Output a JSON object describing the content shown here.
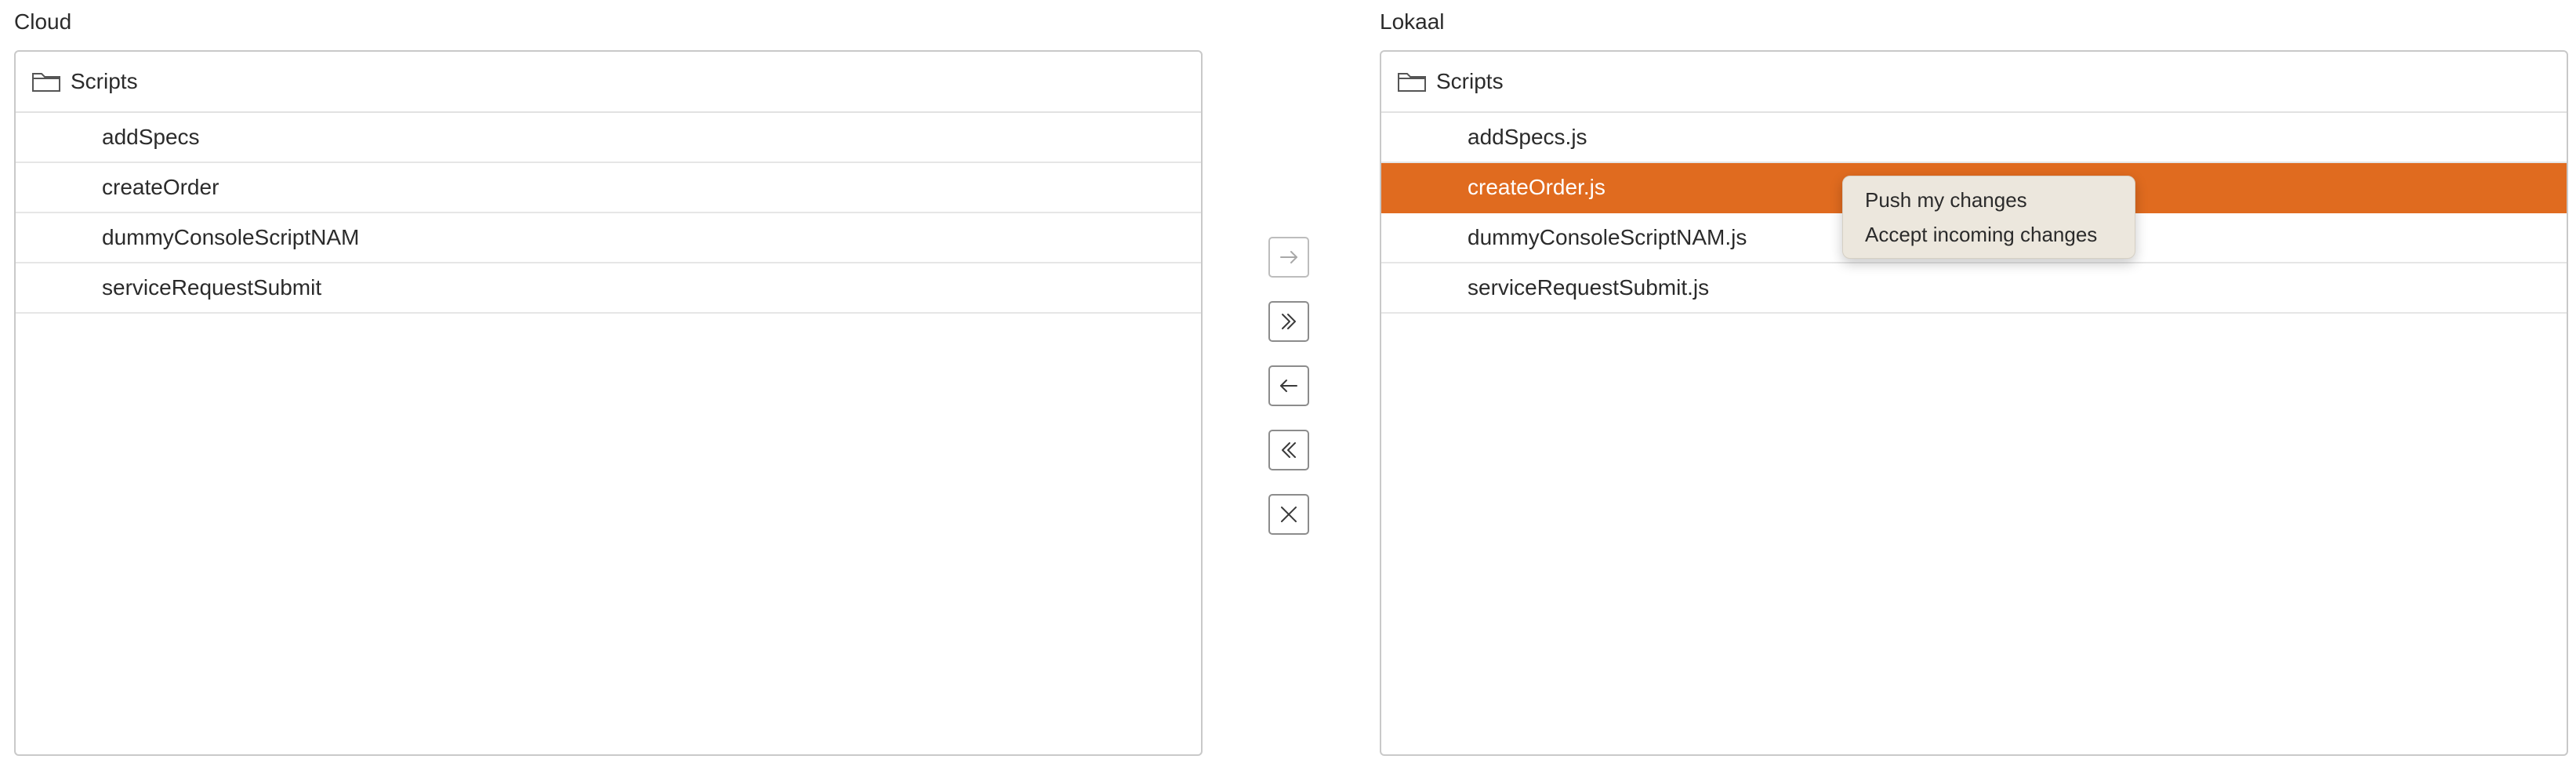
{
  "left_pane": {
    "title": "Cloud",
    "folder": {
      "icon": "folder-icon",
      "label": "Scripts"
    },
    "items": [
      {
        "label": "addSpecs",
        "selected": false
      },
      {
        "label": "createOrder",
        "selected": false
      },
      {
        "label": "dummyConsoleScriptNAM",
        "selected": false
      },
      {
        "label": "serviceRequestSubmit",
        "selected": false
      }
    ]
  },
  "right_pane": {
    "title": "Lokaal",
    "folder": {
      "icon": "folder-icon",
      "label": "Scripts"
    },
    "items": [
      {
        "label": "addSpecs.js",
        "selected": false
      },
      {
        "label": "createOrder.js",
        "selected": true
      },
      {
        "label": "dummyConsoleScriptNAM.js",
        "selected": false
      },
      {
        "label": "serviceRequestSubmit.js",
        "selected": false
      }
    ]
  },
  "transfer_controls": [
    {
      "icon": "arrow-right-icon",
      "enabled": false
    },
    {
      "icon": "double-chevron-right-icon",
      "enabled": true
    },
    {
      "icon": "arrow-left-icon",
      "enabled": true
    },
    {
      "icon": "double-chevron-left-icon",
      "enabled": true
    },
    {
      "icon": "close-icon",
      "enabled": true
    }
  ],
  "context_menu": {
    "items": [
      {
        "label": "Push my changes"
      },
      {
        "label": "Accept incoming changes"
      }
    ]
  },
  "colors": {
    "selection": "#e06b1f",
    "menu_background": "#ece7dd"
  }
}
